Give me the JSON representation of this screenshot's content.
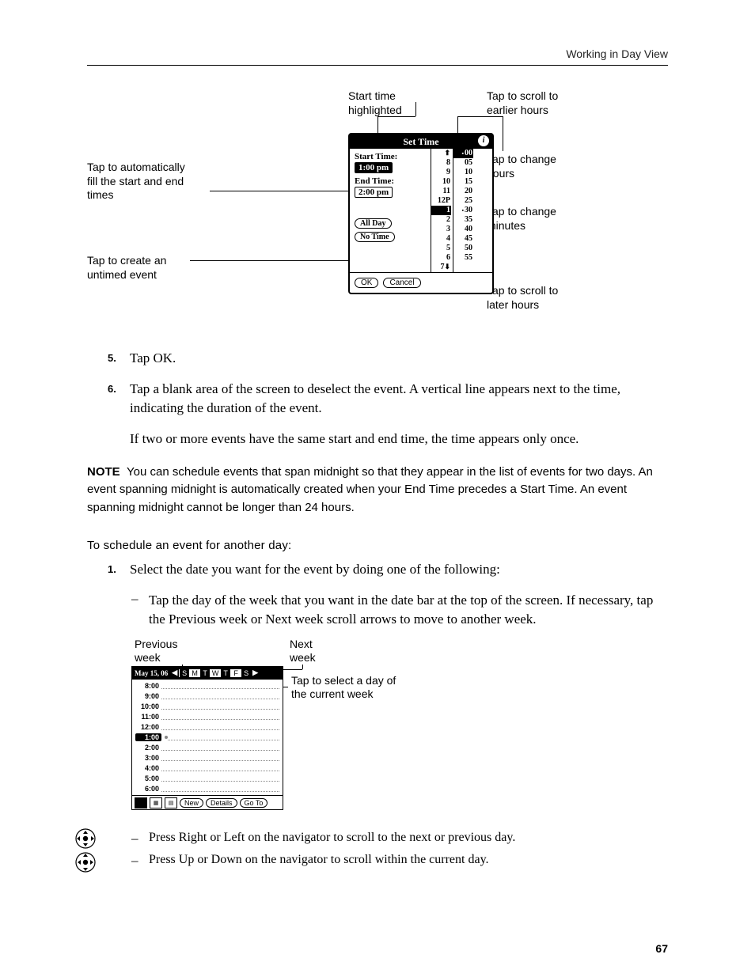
{
  "header": {
    "running": "Working in Day View"
  },
  "fig1": {
    "annot_start": "Start time\nhighlighted",
    "annot_scroll_up": "Tap to scroll to\nearlier hours",
    "annot_auto": "Tap to automatically\nfill the start and end\ntimes",
    "annot_untimed": "Tap to create an\nuntimed event",
    "annot_hours": "Tap to change\nhours",
    "annot_minutes": "Tap to change\nminutes",
    "annot_scroll_dn": "Tap to scroll to\nlater hours",
    "title": "Set Time",
    "start_label": "Start Time:",
    "start_val": "1:00 pm",
    "end_label": "End Time:",
    "end_val": "2:00 pm",
    "all_day": "All Day",
    "no_time": "No Time",
    "ok": "OK",
    "cancel": "Cancel",
    "hours": [
      "8",
      "9",
      "10",
      "11",
      "12P",
      "1",
      "2",
      "3",
      "4",
      "5",
      "6",
      "7"
    ],
    "mins": [
      "00",
      "05",
      "10",
      "15",
      "20",
      "25",
      "30",
      "35",
      "40",
      "45",
      "50",
      "55"
    ]
  },
  "steps": {
    "s5": {
      "n": "5.",
      "text": "Tap OK."
    },
    "s6": {
      "n": "6.",
      "p1": "Tap a blank area of the screen to deselect the event. A vertical line appears next to the time, indicating the duration of the event.",
      "p2": "If two or more events have the same start and end time, the time appears only once."
    }
  },
  "note": {
    "label": "NOTE",
    "text": "You can schedule events that span midnight so that they appear in the list of events for two days. An event spanning midnight is automatically created when your End Time precedes a Start Time. An event spanning midnight cannot be longer than 24 hours."
  },
  "subhead": "To schedule an event for another day:",
  "step1n": "1.",
  "step1": "Select the date you want for the event by doing one of the following:",
  "bullet1": "Tap the day of the week that you want in the date bar at the top of the screen. If necessary, tap the Previous week or Next week scroll arrows to move to another week.",
  "fig2": {
    "prev": "Previous\nweek",
    "next": "Next\nweek",
    "tapday": "Tap to select a day of\nthe current week",
    "date": "May 15, 06",
    "days": [
      "S",
      "M",
      "T",
      "W",
      "T",
      "F",
      "S"
    ],
    "times": [
      "8:00",
      "9:00",
      "10:00",
      "11:00",
      "12:00",
      "1:00",
      "2:00",
      "3:00",
      "4:00",
      "5:00",
      "6:00"
    ],
    "new": "New",
    "details": "Details",
    "goto": "Go To"
  },
  "nav_bullets": {
    "b1": "Press Right or Left on the navigator to scroll to the next or previous day.",
    "b2": "Press Up or Down on the navigator to scroll within the current day."
  },
  "pagenum": "67"
}
